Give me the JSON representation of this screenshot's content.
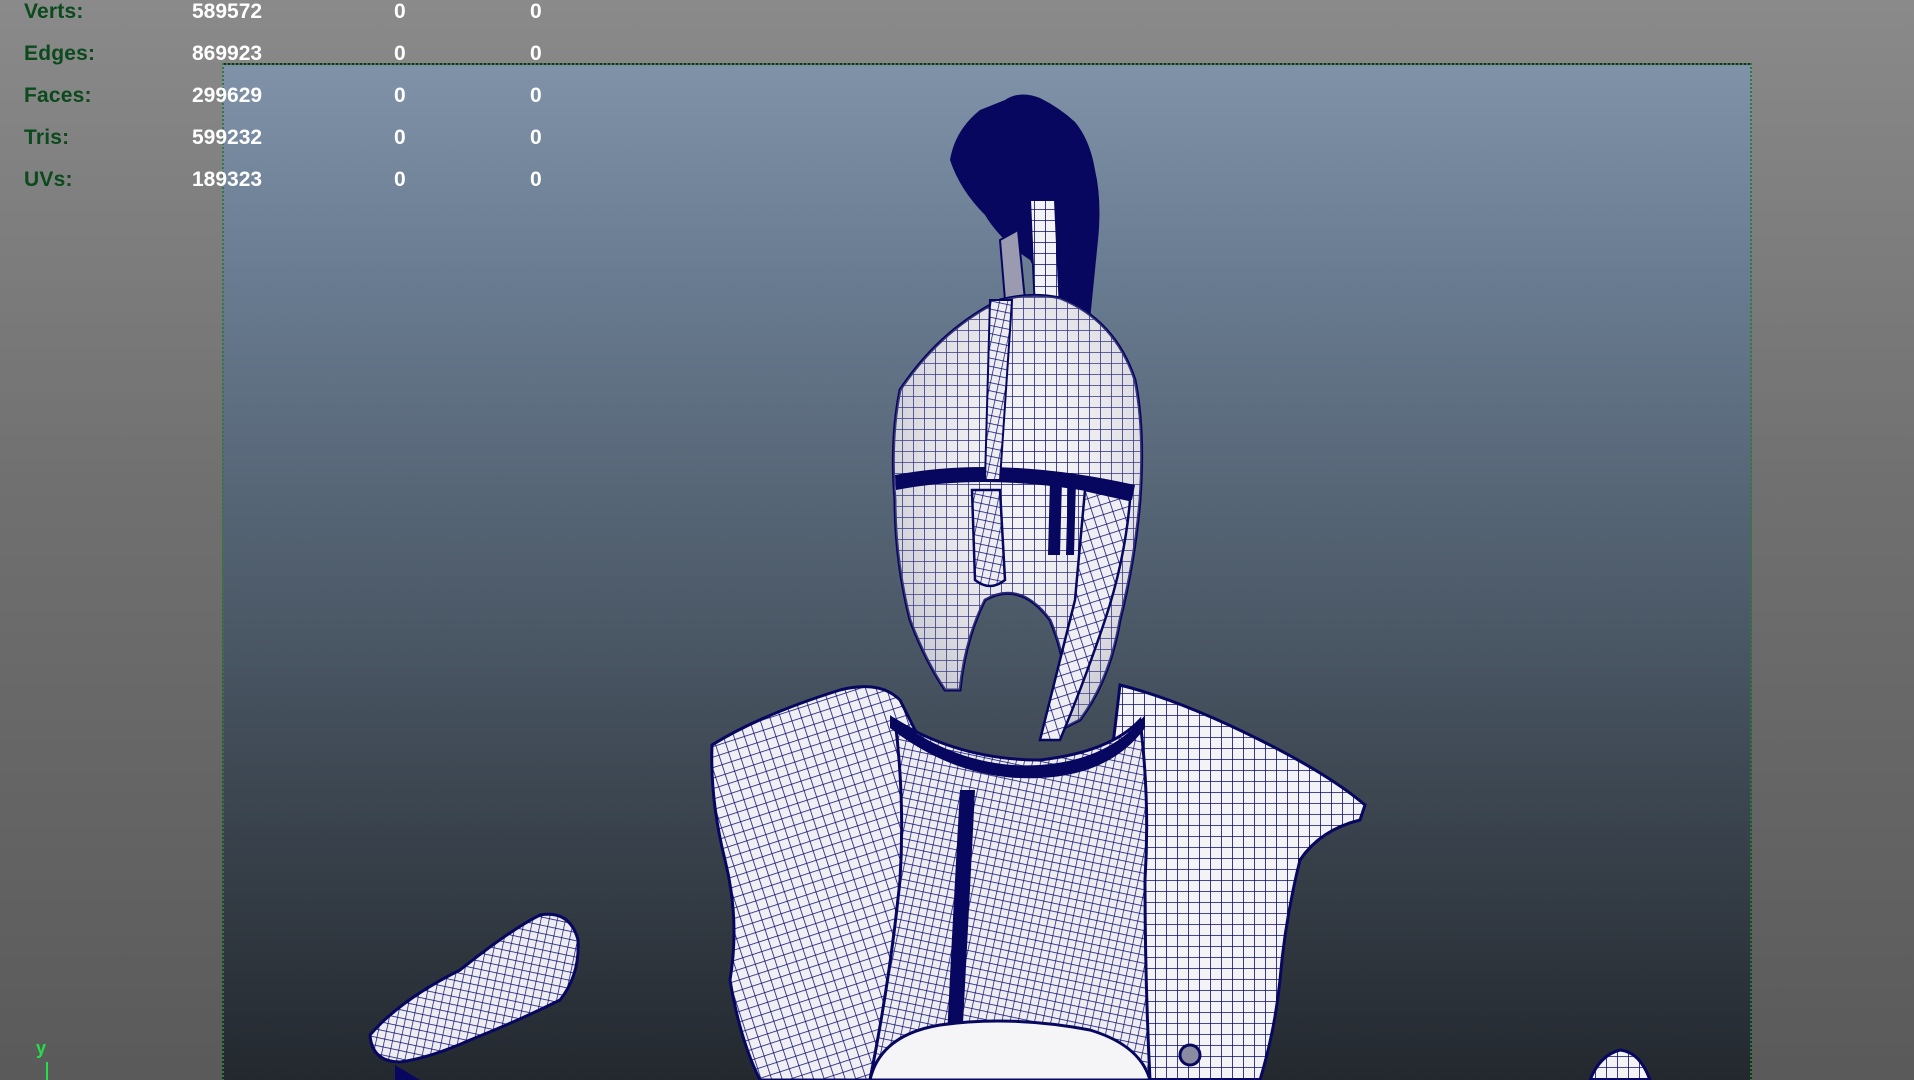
{
  "hud": {
    "rows": [
      {
        "label": "Verts:",
        "v1": "589572",
        "v2": "0",
        "v3": "0"
      },
      {
        "label": "Edges:",
        "v1": "869923",
        "v2": "0",
        "v3": "0"
      },
      {
        "label": "Faces:",
        "v1": "299629",
        "v2": "0",
        "v3": "0"
      },
      {
        "label": "Tris:",
        "v1": "599232",
        "v2": "0",
        "v3": "0"
      },
      {
        "label": "UVs:",
        "v1": "189323",
        "v2": "0",
        "v3": "0"
      }
    ]
  },
  "axis": {
    "label": "y"
  },
  "colors": {
    "wireframe": "#0a0a6e",
    "shaded": "#f2f2f2",
    "hud_label": "#0a4a1c",
    "hud_value": "#ffffff",
    "gate": "#2e7d32",
    "axis": "#22e04a"
  }
}
